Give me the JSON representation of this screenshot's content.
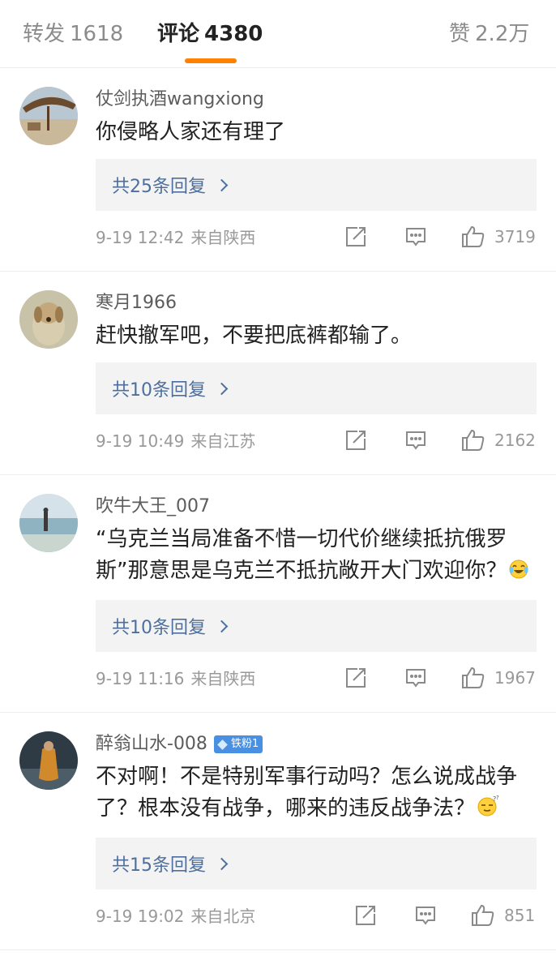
{
  "tabs": {
    "repost": {
      "label": "转发",
      "count": "1618"
    },
    "comments": {
      "label": "评论",
      "count": "4380"
    },
    "likes": {
      "label": "赞",
      "count": "2.2万"
    }
  },
  "colors": {
    "active_indicator": "#ff8200",
    "link": "#4e6f9d",
    "fan_badge": "#4a90e2"
  },
  "comments": [
    {
      "username": "仗剑执酒wangxiong",
      "text": "你侵略人家还有理了",
      "replies": "共25条回复",
      "time": "9-19 12:42",
      "location": "来自陕西",
      "likes": "3719"
    },
    {
      "username": "寒月1966",
      "text": "赶快撤军吧，不要把底裤都输了。",
      "replies": "共10条回复",
      "time": "9-19 10:49",
      "location": "来自江苏",
      "likes": "2162"
    },
    {
      "username": "吹牛大王_007",
      "text": "“乌克兰当局准备不惜一切代价继续抵抗俄罗斯”那意思是乌克兰不抵抗敞开大门欢迎你？",
      "emoji": "laughing-tears-emoji",
      "replies": "共10条回复",
      "time": "9-19 11:16",
      "location": "来自陕西",
      "likes": "1967"
    },
    {
      "username": "醉翁山水-008",
      "badge": "铁粉1",
      "text": "不对啊！不是特别军事行动吗？怎么说成战争了？根本没有战争，哪来的违反战争法？",
      "emoji": "sleepy-sweat-emoji",
      "replies": "共15条回复",
      "time": "9-19 19:02",
      "location": "来自北京",
      "likes": "851"
    }
  ],
  "icons": {
    "repost": "share-icon",
    "comment": "comment-icon",
    "like": "thumbs-up-icon",
    "chevron": "chevron-right-icon"
  }
}
